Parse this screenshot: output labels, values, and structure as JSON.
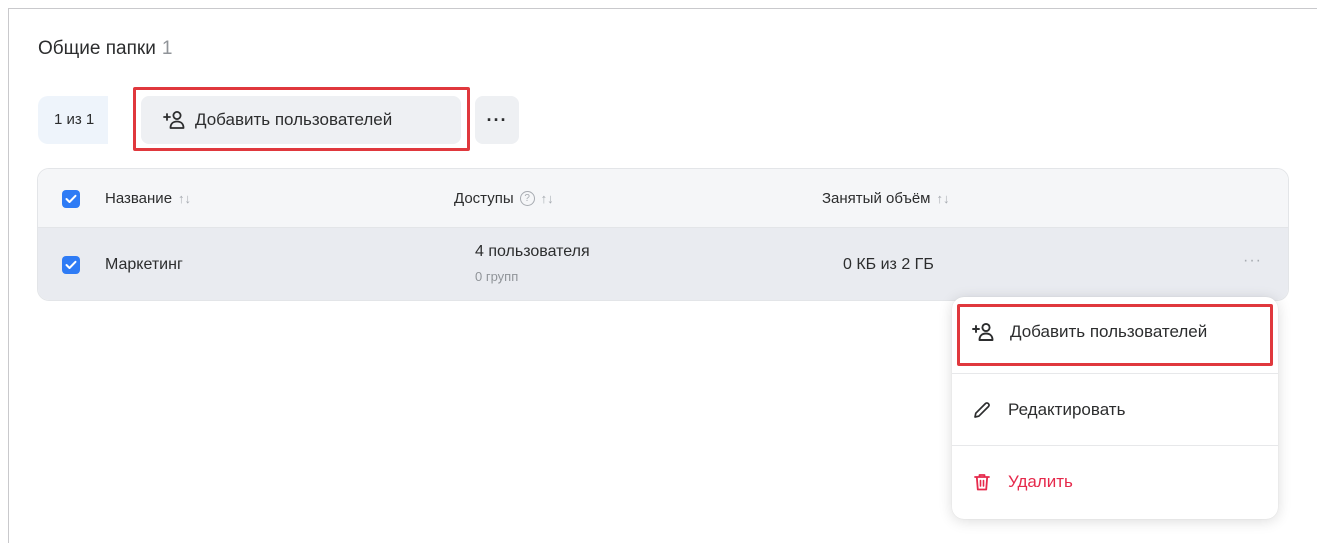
{
  "page": {
    "title": "Общие папки",
    "count": "1"
  },
  "toolbar": {
    "counter": "1 из 1",
    "add_users_label": "Добавить пользователей",
    "more_label": "···"
  },
  "table": {
    "columns": [
      {
        "label": "Название"
      },
      {
        "label": "Доступы"
      },
      {
        "label": "Занятый объём"
      }
    ],
    "help_glyph": "?",
    "sort_glyph": "↑↓",
    "rows": [
      {
        "name": "Маркетинг",
        "users": "4 пользователя",
        "groups": "0 групп",
        "size": "0 КБ из 2 ГБ",
        "more": "···"
      }
    ]
  },
  "context_menu": {
    "items": [
      {
        "label": "Добавить пользователей",
        "icon": "add-user-icon"
      },
      {
        "label": "Редактировать",
        "icon": "pencil-icon"
      },
      {
        "label": "Удалить",
        "icon": "trash-icon",
        "color": "#e6294b"
      }
    ]
  },
  "colors": {
    "accent": "#2e7bf5",
    "highlight": "#e0383d",
    "danger": "#e6294b"
  }
}
